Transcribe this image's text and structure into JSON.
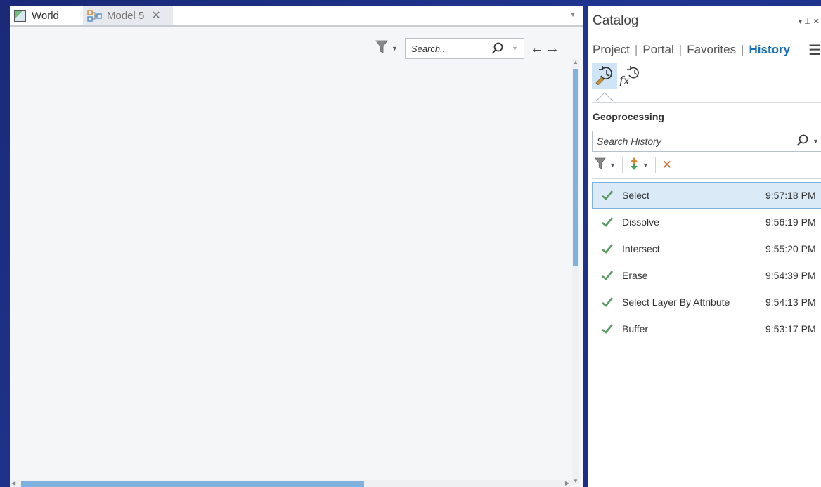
{
  "tabs": {
    "world_label": "World",
    "model_label": "Model 5",
    "close_glyph": "✕"
  },
  "main_toolbar": {
    "search_placeholder": "Search...",
    "arrows": "←→"
  },
  "catalog": {
    "title": "Catalog",
    "header_controls": "▾ ⊥ ✕",
    "nav": {
      "project": "Project",
      "portal": "Portal",
      "favorites": "Favorites",
      "history": "History",
      "separator": "|"
    },
    "section_title": "Geoprocessing",
    "search_placeholder": "Search History",
    "history_items": [
      {
        "name": "Select",
        "time": "9:57:18 PM"
      },
      {
        "name": "Dissolve",
        "time": "9:56:19 PM"
      },
      {
        "name": "Intersect",
        "time": "9:55:20 PM"
      },
      {
        "name": "Erase",
        "time": "9:54:39 PM"
      },
      {
        "name": "Select Layer By Attribute",
        "time": "9:54:13 PM"
      },
      {
        "name": "Buffer",
        "time": "9:53:17 PM"
      }
    ]
  },
  "colors": {
    "accent": "#1a6fb5",
    "selection": "#dbeaf7",
    "check": "#5a9a5e",
    "delete": "#d06a2a",
    "background": "#1f3590"
  },
  "icons": [
    "map-icon",
    "model-icon",
    "filter-icon",
    "search-icon",
    "history-tool-icon",
    "history-function-icon",
    "sort-icon",
    "delete-icon",
    "success-check-icon",
    "menu-icon"
  ]
}
